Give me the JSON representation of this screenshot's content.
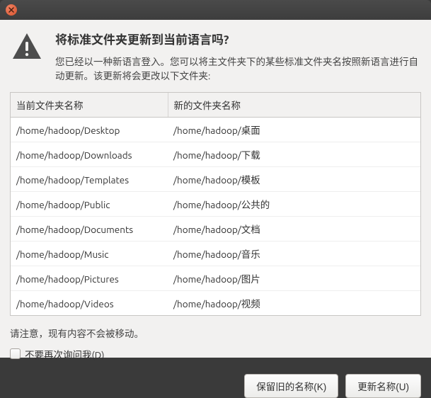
{
  "dialog": {
    "title": "将标准文件夹更新到当前语言吗?",
    "subtitle": "您已经以一种新语言登入。您可以将主文件夹下的某些标准文件夹名按照新语言进行自动更新。该更新将会更改以下文件夹:"
  },
  "table": {
    "headers": {
      "current": "当前文件夹名称",
      "new": "新的文件夹名称"
    },
    "rows": [
      {
        "current": "/home/hadoop/Desktop",
        "new": "/home/hadoop/桌面"
      },
      {
        "current": "/home/hadoop/Downloads",
        "new": "/home/hadoop/下载"
      },
      {
        "current": "/home/hadoop/Templates",
        "new": "/home/hadoop/模板"
      },
      {
        "current": "/home/hadoop/Public",
        "new": "/home/hadoop/公共的"
      },
      {
        "current": "/home/hadoop/Documents",
        "new": "/home/hadoop/文档"
      },
      {
        "current": "/home/hadoop/Music",
        "new": "/home/hadoop/音乐"
      },
      {
        "current": "/home/hadoop/Pictures",
        "new": "/home/hadoop/图片"
      },
      {
        "current": "/home/hadoop/Videos",
        "new": "/home/hadoop/视频"
      }
    ]
  },
  "note": "请注意，现有内容不会被移动。",
  "checkbox": {
    "label": "不要再次询问我(D)",
    "checked": false
  },
  "buttons": {
    "keep": "保留旧的名称(K)",
    "update": "更新名称(U)"
  },
  "colors": {
    "accent": "#e95420"
  }
}
